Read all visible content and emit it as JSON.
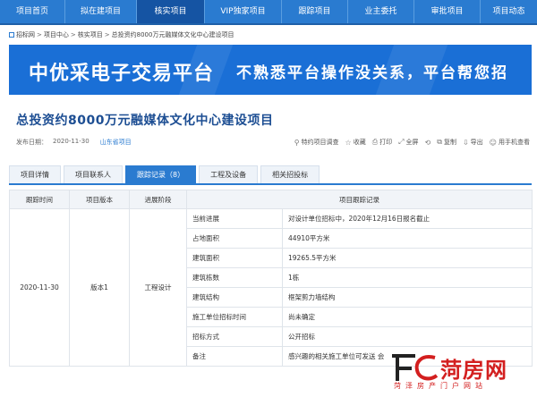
{
  "nav": {
    "items": [
      "项目首页",
      "拟在建项目",
      "核实项目",
      "VIP独家项目",
      "跟踪项目",
      "业主委托",
      "审批项目",
      "项目动态"
    ],
    "active_index": 2
  },
  "breadcrumb": [
    "招标网",
    "项目中心",
    "核实项目",
    "总投资约8000万元融媒体文化中心建设项目"
  ],
  "banner": {
    "title": "中优采电子交易平台",
    "slogan": "不熟悉平台操作没关系，平台帮您招"
  },
  "page": {
    "title": "总投资约8000万元融媒体文化中心建设项目",
    "date_label": "发布日期：",
    "date": "2020-11-30",
    "region": "山东省项目"
  },
  "toolbar": {
    "items": [
      {
        "icon": "search-icon",
        "label": "特约项目调查"
      },
      {
        "icon": "star-icon",
        "label": "收藏"
      },
      {
        "icon": "print-icon",
        "label": "打印"
      },
      {
        "icon": "fullscreen-icon",
        "label": "全屏"
      },
      {
        "icon": "share-icon",
        "label": ""
      },
      {
        "icon": "copy-icon",
        "label": "复制"
      },
      {
        "icon": "export-icon",
        "label": "导出"
      },
      {
        "icon": "user-icon",
        "label": "用手机查看"
      }
    ]
  },
  "tabs": {
    "items": [
      "项目详情",
      "项目联系人",
      "跟踪记录（8）",
      "工程及设备",
      "相关招投标"
    ],
    "active_index": 2
  },
  "table": {
    "headers": [
      "跟踪时间",
      "项目版本",
      "进展阶段",
      "项目跟踪记录"
    ],
    "time": "2020-11-30",
    "version": "版本1",
    "stage": "工程设计",
    "rows": [
      {
        "label": "当前进展",
        "value": "对设计单位招标中，2020年12月16日报名截止"
      },
      {
        "label": "占地面积",
        "value": "44910平方米"
      },
      {
        "label": "建筑面积",
        "value": "19265.5平方米"
      },
      {
        "label": "建筑栋数",
        "value": "1栋"
      },
      {
        "label": "建筑结构",
        "value": "框架剪力墙结构"
      },
      {
        "label": "施工单位招标时间",
        "value": "尚未确定"
      },
      {
        "label": "招标方式",
        "value": "公开招标"
      },
      {
        "label": "备注",
        "value": "感兴趣的相关施工单位可发送 会"
      }
    ]
  },
  "watermark": {
    "brand": "菏房网",
    "tagline": "菏泽房产门户网站",
    "color": "#d31f1f"
  },
  "colors": {
    "nav_bg": "#2a7bd0",
    "nav_active": "#1554a3",
    "banner_bg": "#1a6fd6",
    "title": "#1d4e93"
  }
}
